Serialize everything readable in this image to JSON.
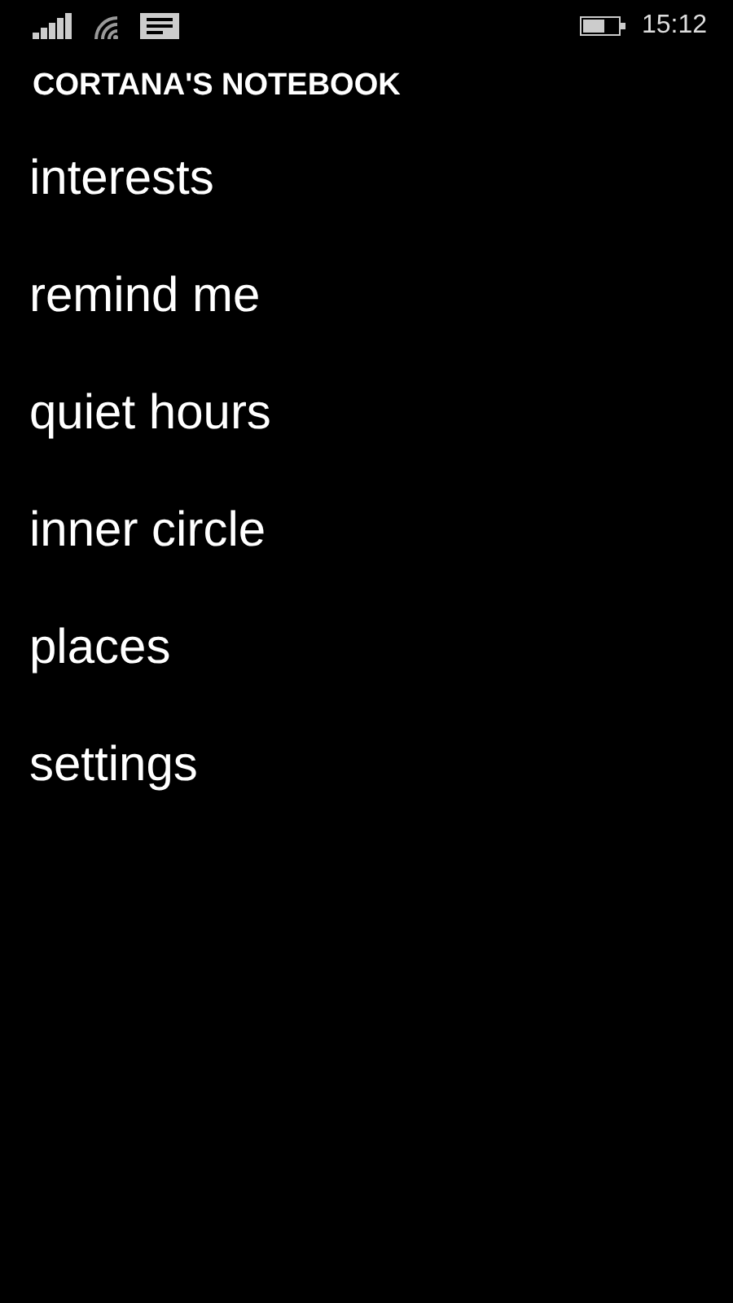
{
  "status_bar": {
    "time": "15:12"
  },
  "title": "CORTANA'S NOTEBOOK",
  "menu_items": [
    {
      "label": "interests"
    },
    {
      "label": "remind me"
    },
    {
      "label": "quiet hours"
    },
    {
      "label": "inner circle"
    },
    {
      "label": "places"
    },
    {
      "label": "settings"
    }
  ]
}
